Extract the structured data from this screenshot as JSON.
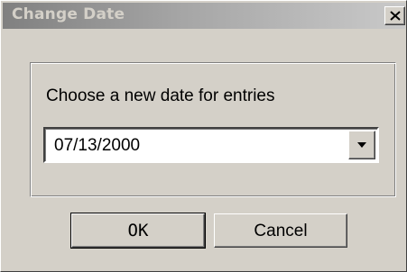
{
  "window": {
    "title": "Change Date"
  },
  "dialog": {
    "prompt": "Choose a new date for entries",
    "date_combo": {
      "value": "07/13/2000"
    },
    "ok_label": "OK",
    "cancel_label": "Cancel"
  },
  "icons": {
    "close": "close-icon",
    "dropdown": "chevron-down-icon"
  },
  "colors": {
    "face": "#d4d0c8",
    "titlebar_inactive_start": "#808080",
    "titlebar_inactive_end": "#c9c9c9",
    "title_text": "#d4d0c8"
  }
}
